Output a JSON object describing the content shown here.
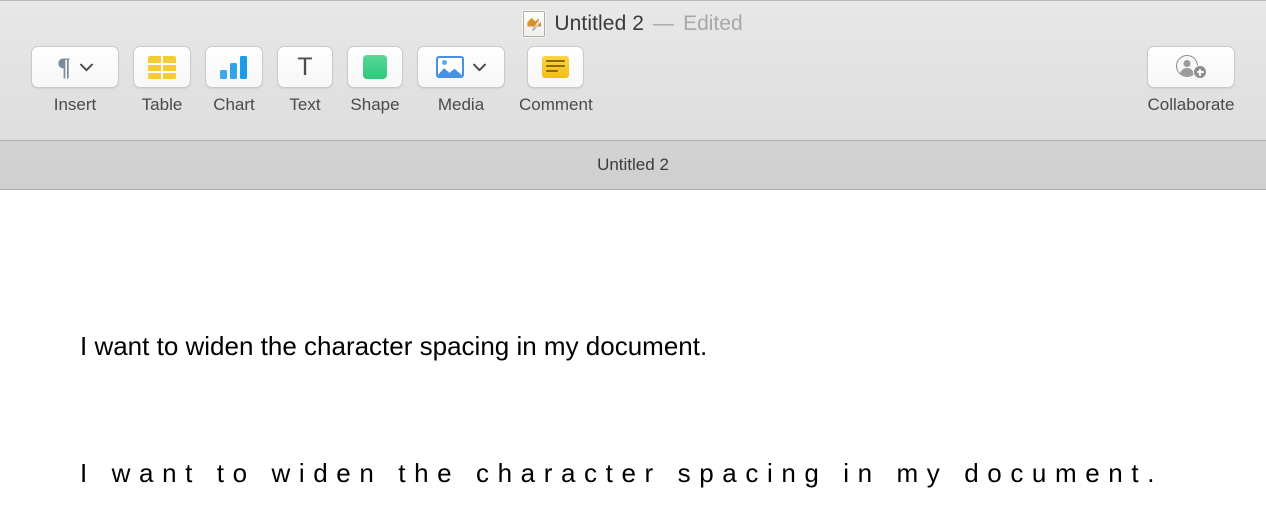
{
  "window": {
    "title": "Untitled 2",
    "title_separator": "—",
    "edited_badge": "Edited",
    "doc_icon": "pages-document-icon"
  },
  "toolbar": {
    "items": [
      {
        "label": "Insert",
        "icon": "pilcrow-icon",
        "has_chevron": true
      },
      {
        "label": "Table",
        "icon": "table-icon",
        "has_chevron": false
      },
      {
        "label": "Chart",
        "icon": "bar-chart-icon",
        "has_chevron": false
      },
      {
        "label": "Text",
        "icon": "text-t-icon",
        "has_chevron": false
      },
      {
        "label": "Shape",
        "icon": "shape-icon",
        "has_chevron": false
      },
      {
        "label": "Media",
        "icon": "photo-icon",
        "has_chevron": true
      },
      {
        "label": "Comment",
        "icon": "sticky-note-icon",
        "has_chevron": false
      }
    ],
    "collaborate": {
      "label": "Collaborate",
      "icon": "add-person-icon"
    }
  },
  "tabbar": {
    "document_name": "Untitled 2"
  },
  "document": {
    "paragraph_normal": "I want to widen the character spacing in my document.",
    "paragraph_spaced": "I want to widen the character spacing in my document."
  },
  "colors": {
    "chrome": "#e3e3e3",
    "tabbar": "#d1d1d1",
    "table_icon": "#f5cb36",
    "chart_icon": "#1d9ae8",
    "shape_icon": "#2fc87c",
    "media_icon": "#4a90e2",
    "comment_icon": "#f2bd1b",
    "text": "#000000"
  }
}
